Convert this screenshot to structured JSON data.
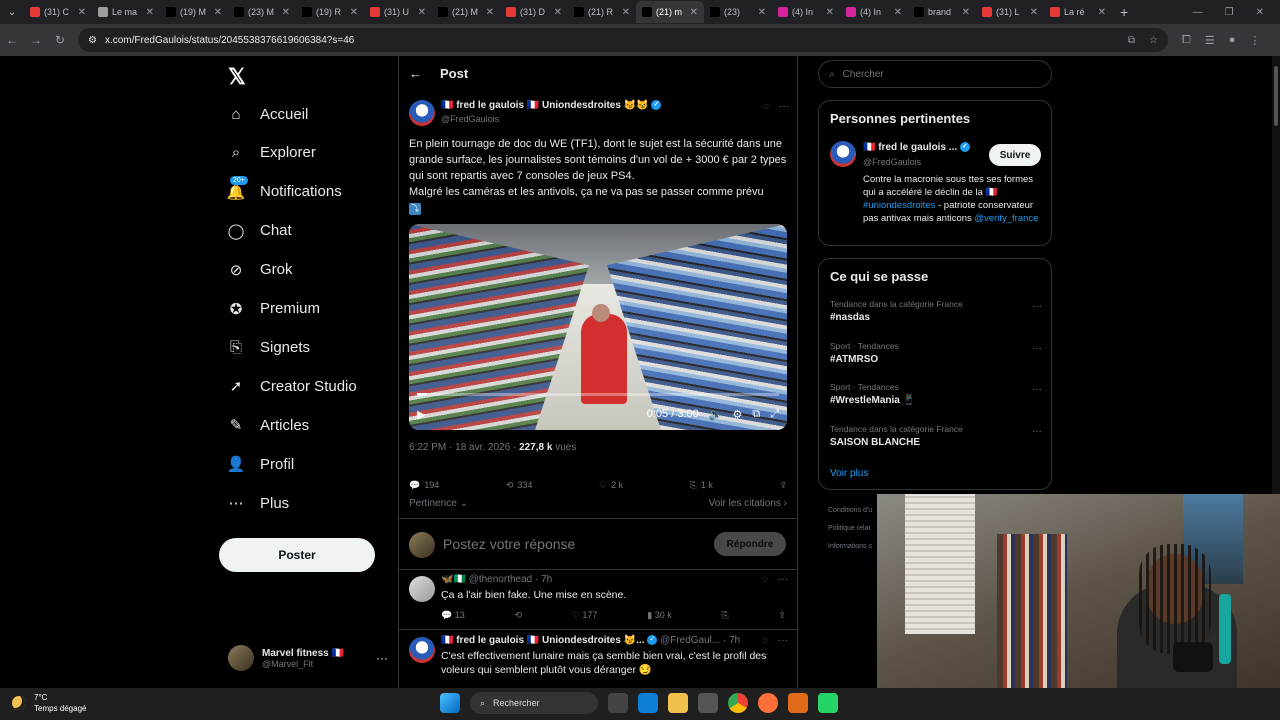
{
  "browser": {
    "tabs": [
      {
        "title": "(31) C",
        "fav_color": "#e53935"
      },
      {
        "title": "Le ma",
        "fav_color": "#9e9e9e"
      },
      {
        "title": "(19) M",
        "fav_color": "#000000"
      },
      {
        "title": "(23) M",
        "fav_color": "#000000"
      },
      {
        "title": "(19) R",
        "fav_color": "#000000"
      },
      {
        "title": "(31) U",
        "fav_color": "#e53935"
      },
      {
        "title": "(21) M",
        "fav_color": "#000000"
      },
      {
        "title": "(31) D",
        "fav_color": "#e53935"
      },
      {
        "title": "(21) R",
        "fav_color": "#000000"
      },
      {
        "title": "(21) m",
        "fav_color": "#000000"
      },
      {
        "title": "(23)",
        "fav_color": "#000000"
      },
      {
        "title": "(4) In",
        "fav_color": "#d6249f"
      },
      {
        "title": "(4) In",
        "fav_color": "#d6249f"
      },
      {
        "title": "brand",
        "fav_color": "#000000"
      },
      {
        "title": "(31) L",
        "fav_color": "#e53935"
      },
      {
        "title": "La ré",
        "fav_color": "#e53935"
      }
    ],
    "active_tab_index": 9,
    "url": "x.com/FredGaulois/status/2045538376619606384?s=46"
  },
  "nav": {
    "items": [
      {
        "label": "Accueil",
        "icon": "home-icon"
      },
      {
        "label": "Explorer",
        "icon": "search-icon"
      },
      {
        "label": "Notifications",
        "icon": "bell-icon",
        "badge": "20+"
      },
      {
        "label": "Chat",
        "icon": "chat-icon"
      },
      {
        "label": "Grok",
        "icon": "grok-icon"
      },
      {
        "label": "Premium",
        "icon": "premium-icon"
      },
      {
        "label": "Signets",
        "icon": "bookmark-icon"
      },
      {
        "label": "Creator Studio",
        "icon": "rocket-icon"
      },
      {
        "label": "Articles",
        "icon": "article-icon"
      },
      {
        "label": "Profil",
        "icon": "profile-icon"
      },
      {
        "label": "Plus",
        "icon": "more-icon"
      }
    ],
    "post_button": "Poster",
    "account": {
      "name": "Marvel fitness 🇫🇷",
      "handle": "@Marvel_Flt"
    }
  },
  "post": {
    "header": "Post",
    "author": {
      "name": "🇫🇷 fred le gaulois 🇫🇷 Uniondesdroites 😼😼",
      "handle": "@FredGaulois"
    },
    "text_lines": [
      "En plein tournage de doc du WE (TF1), dont le sujet est la sécurité dans une grande surface, les journalistes sont témoins d'un vol de + 3000 € par 2 types qui sont repartis avec 7 consoles de jeux PS4.",
      "Malgré les caméras et les antivols, ça ne va pas se passer comme prévu"
    ],
    "video": {
      "time": "0:05 / 3:00",
      "progress": 0.028
    },
    "timestamp": "6:22 PM · 18 avr. 2026 · ",
    "views": "227,8 k",
    "views_label": "vues",
    "stats": {
      "replies": "194",
      "reposts": "334",
      "likes": "2 k",
      "bookmarks": "1 k"
    },
    "sort_label": "Pertinence",
    "quotes_label": "Voir les citations",
    "reply_placeholder": "Postez votre réponse",
    "reply_button": "Répondre"
  },
  "replies": [
    {
      "name": "🦋🇳🇬",
      "handle": "@thenorthead · 7h",
      "text": "Ça a l'air bien fake. Une mise en scène.",
      "stats": {
        "replies": "13",
        "likes": "177",
        "views": "30 k"
      }
    },
    {
      "name": "🇫🇷 fred le gaulois 🇫🇷 Uniondesdroites 😼...",
      "handle": "@FredGaul... · 7h",
      "text": "C'est effectivement lunaire mais ça semble bien vrai, c'est le profil des voleurs qui semblent plutôt vous déranger 😏"
    }
  ],
  "right": {
    "search_placeholder": "Chercher",
    "relevant_title": "Personnes pertinentes",
    "relevant": {
      "name": "🇫🇷 fred le gaulois ...",
      "handle": "@FredGaulois",
      "follow": "Suivre",
      "bio_pre": "Contre la macronie sous ttes ses formes qui a accéléré le déclin de la 🇫🇷 ",
      "bio_tag": "#uniondesdroites",
      "bio_mid": " - patriote conservateur pas antivax mais anticons ",
      "bio_tag2": "@verity_france"
    },
    "trends_title": "Ce qui se passe",
    "trends": [
      {
        "category": "Tendance dans la catégorie France",
        "name": "#nasdas"
      },
      {
        "category": "Sport · Tendances",
        "name": "#ATMRSO"
      },
      {
        "category": "Sport · Tendances",
        "name": "#WrestleMania 📱"
      },
      {
        "category": "Tendance dans la catégorie France",
        "name": "SAISON BLANCHE"
      }
    ],
    "see_more": "Voir plus",
    "footer": [
      "Conditions d'u",
      "Politique relat",
      "Informations s"
    ]
  },
  "taskbar": {
    "weather_temp": "7°C",
    "weather_desc": "Temps dégagé",
    "search_label": "Rechercher"
  }
}
